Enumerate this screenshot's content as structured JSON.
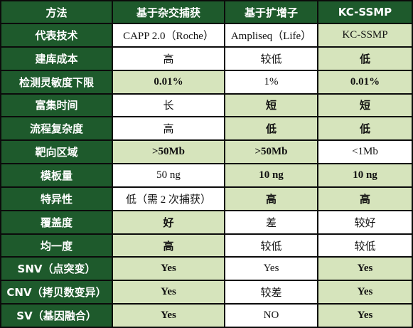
{
  "colors": {
    "header_bg": "#1e5a2c",
    "highlight_bg": "#d6e4bc",
    "plain_bg": "#ffffff",
    "border": "#0b0b0b"
  },
  "table": {
    "headers": [
      "方法",
      "基于杂交捕获",
      "基于扩增子",
      "KC-SSMP"
    ],
    "rows": [
      {
        "label": "代表技术",
        "cells": [
          {
            "text": "CAPP 2.0（Roche）",
            "hl": false,
            "bold": false
          },
          {
            "text": "Ampliseq（Life）",
            "hl": false,
            "bold": false
          },
          {
            "text": "KC-SSMP",
            "hl": true,
            "bold": false
          }
        ]
      },
      {
        "label": "建库成本",
        "cells": [
          {
            "text": "高",
            "hl": false,
            "bold": false
          },
          {
            "text": "较低",
            "hl": false,
            "bold": false
          },
          {
            "text": "低",
            "hl": true,
            "bold": true
          }
        ]
      },
      {
        "label": "检测灵敏度下限",
        "cells": [
          {
            "text": "0.01%",
            "hl": true,
            "bold": true
          },
          {
            "text": "1%",
            "hl": false,
            "bold": false
          },
          {
            "text": "0.01%",
            "hl": true,
            "bold": true
          }
        ]
      },
      {
        "label": "富集时间",
        "cells": [
          {
            "text": "长",
            "hl": false,
            "bold": false
          },
          {
            "text": "短",
            "hl": true,
            "bold": true
          },
          {
            "text": "短",
            "hl": true,
            "bold": true
          }
        ]
      },
      {
        "label": "流程复杂度",
        "cells": [
          {
            "text": "高",
            "hl": false,
            "bold": false
          },
          {
            "text": "低",
            "hl": true,
            "bold": true
          },
          {
            "text": "低",
            "hl": true,
            "bold": true
          }
        ]
      },
      {
        "label": "靶向区域",
        "cells": [
          {
            "text": ">50Mb",
            "hl": true,
            "bold": true
          },
          {
            "text": ">50Mb",
            "hl": true,
            "bold": true
          },
          {
            "text": "<1Mb",
            "hl": false,
            "bold": false
          }
        ]
      },
      {
        "label": "模板量",
        "cells": [
          {
            "text": "50 ng",
            "hl": false,
            "bold": false
          },
          {
            "text": "10 ng",
            "hl": true,
            "bold": true
          },
          {
            "text": "10 ng",
            "hl": true,
            "bold": true
          }
        ]
      },
      {
        "label": "特异性",
        "cells": [
          {
            "text": "低（需 2 次捕获）",
            "hl": false,
            "bold": false
          },
          {
            "text": "高",
            "hl": true,
            "bold": true
          },
          {
            "text": "高",
            "hl": true,
            "bold": true
          }
        ]
      },
      {
        "label": "覆盖度",
        "cells": [
          {
            "text": "好",
            "hl": true,
            "bold": true
          },
          {
            "text": "差",
            "hl": false,
            "bold": false
          },
          {
            "text": "较好",
            "hl": false,
            "bold": false
          }
        ]
      },
      {
        "label": "均一度",
        "cells": [
          {
            "text": "高",
            "hl": true,
            "bold": true
          },
          {
            "text": "较低",
            "hl": false,
            "bold": false
          },
          {
            "text": "较低",
            "hl": false,
            "bold": false
          }
        ]
      },
      {
        "label": "SNV（点突变）",
        "cells": [
          {
            "text": "Yes",
            "hl": true,
            "bold": true
          },
          {
            "text": "Yes",
            "hl": false,
            "bold": false
          },
          {
            "text": "Yes",
            "hl": true,
            "bold": true
          }
        ]
      },
      {
        "label": "CNV（拷贝数变异）",
        "cells": [
          {
            "text": "Yes",
            "hl": true,
            "bold": true
          },
          {
            "text": "较差",
            "hl": false,
            "bold": false
          },
          {
            "text": "Yes",
            "hl": true,
            "bold": true
          }
        ]
      },
      {
        "label": "SV（基因融合）",
        "cells": [
          {
            "text": "Yes",
            "hl": true,
            "bold": true
          },
          {
            "text": "NO",
            "hl": false,
            "bold": false
          },
          {
            "text": "Yes",
            "hl": true,
            "bold": true
          }
        ]
      }
    ]
  }
}
